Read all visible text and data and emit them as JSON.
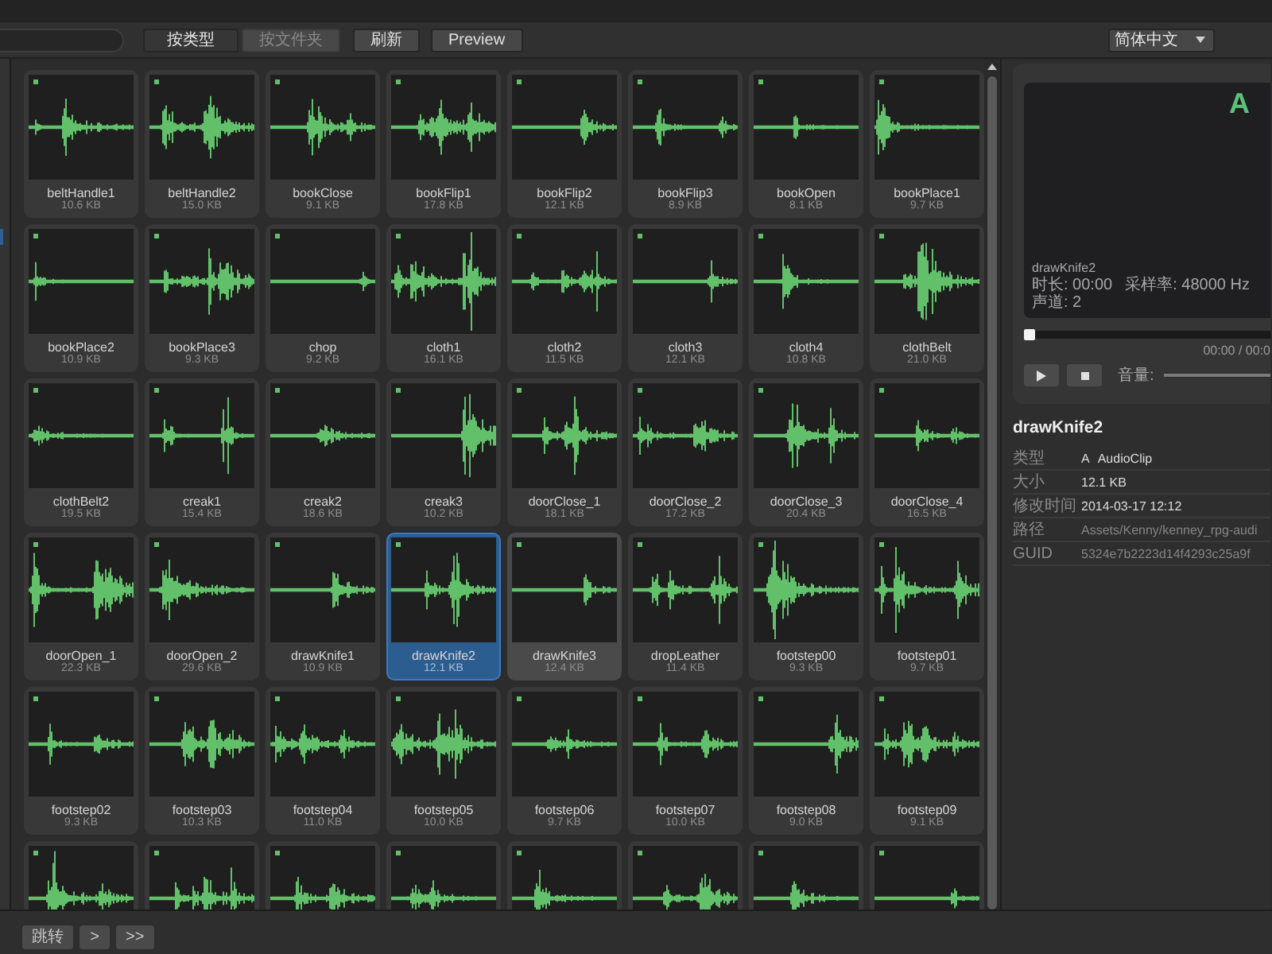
{
  "toolbar": {
    "view_toggle": [
      {
        "label": "按类型",
        "selected": true
      },
      {
        "label": "按文件夹",
        "selected": false
      }
    ],
    "buttons": [
      "刷新",
      "Preview"
    ],
    "language": "简体中文"
  },
  "clips": [
    {
      "kind": "clip",
      "name": "beltHandle1",
      "size": "10.6 KB",
      "selected": false,
      "hovered": false
    },
    {
      "kind": "clip",
      "name": "beltHandle2",
      "size": "15.0 KB",
      "selected": false,
      "hovered": false
    },
    {
      "kind": "clip",
      "name": "bookClose",
      "size": "9.1 KB",
      "selected": false,
      "hovered": false
    },
    {
      "kind": "clip",
      "name": "bookFlip1",
      "size": "17.8 KB",
      "selected": false,
      "hovered": false
    },
    {
      "kind": "clip",
      "name": "bookFlip2",
      "size": "12.1 KB",
      "selected": false,
      "hovered": false
    },
    {
      "kind": "clip",
      "name": "bookFlip3",
      "size": "8.9 KB",
      "selected": false,
      "hovered": false
    },
    {
      "kind": "clip",
      "name": "bookOpen",
      "size": "8.1 KB",
      "selected": false,
      "hovered": false
    },
    {
      "kind": "clip",
      "name": "bookPlace1",
      "size": "9.7 KB",
      "selected": false,
      "hovered": false
    },
    {
      "kind": "clip",
      "name": "bookPlace2",
      "size": "10.9 KB",
      "selected": false,
      "hovered": false
    },
    {
      "kind": "clip",
      "name": "bookPlace3",
      "size": "9.3 KB",
      "selected": false,
      "hovered": false
    },
    {
      "kind": "clip",
      "name": "chop",
      "size": "9.2 KB",
      "selected": false,
      "hovered": false
    },
    {
      "kind": "clip",
      "name": "cloth1",
      "size": "16.1 KB",
      "selected": false,
      "hovered": false
    },
    {
      "kind": "clip",
      "name": "cloth2",
      "size": "11.5 KB",
      "selected": false,
      "hovered": false
    },
    {
      "kind": "clip",
      "name": "cloth3",
      "size": "12.1 KB",
      "selected": false,
      "hovered": false
    },
    {
      "kind": "clip",
      "name": "cloth4",
      "size": "10.8 KB",
      "selected": false,
      "hovered": false
    },
    {
      "kind": "clip",
      "name": "clothBelt",
      "size": "21.0 KB",
      "selected": false,
      "hovered": false
    },
    {
      "kind": "clip",
      "name": "clothBelt2",
      "size": "19.5 KB",
      "selected": false,
      "hovered": false
    },
    {
      "kind": "clip",
      "name": "creak1",
      "size": "15.4 KB",
      "selected": false,
      "hovered": false
    },
    {
      "kind": "clip",
      "name": "creak2",
      "size": "18.6 KB",
      "selected": false,
      "hovered": false
    },
    {
      "kind": "clip",
      "name": "creak3",
      "size": "10.2 KB",
      "selected": false,
      "hovered": false
    },
    {
      "kind": "clip",
      "name": "doorClose_1",
      "size": "18.1 KB",
      "selected": false,
      "hovered": false
    },
    {
      "kind": "clip",
      "name": "doorClose_2",
      "size": "17.2 KB",
      "selected": false,
      "hovered": false
    },
    {
      "kind": "clip",
      "name": "doorClose_3",
      "size": "20.4 KB",
      "selected": false,
      "hovered": false
    },
    {
      "kind": "clip",
      "name": "doorClose_4",
      "size": "16.5 KB",
      "selected": false,
      "hovered": false
    },
    {
      "kind": "clip",
      "name": "doorOpen_1",
      "size": "22.3 KB",
      "selected": false,
      "hovered": false
    },
    {
      "kind": "clip",
      "name": "doorOpen_2",
      "size": "29.6 KB",
      "selected": false,
      "hovered": false
    },
    {
      "kind": "clip",
      "name": "drawKnife1",
      "size": "10.9 KB",
      "selected": false,
      "hovered": false
    },
    {
      "kind": "clip",
      "name": "drawKnife2",
      "size": "12.1 KB",
      "selected": true,
      "hovered": false
    },
    {
      "kind": "clip",
      "name": "drawKnife3",
      "size": "12.4 KB",
      "selected": false,
      "hovered": true
    },
    {
      "kind": "clip",
      "name": "dropLeather",
      "size": "11.4 KB",
      "selected": false,
      "hovered": false
    },
    {
      "kind": "clip",
      "name": "footstep00",
      "size": "9.3 KB",
      "selected": false,
      "hovered": false
    },
    {
      "kind": "clip",
      "name": "footstep01",
      "size": "9.7 KB",
      "selected": false,
      "hovered": false
    },
    {
      "kind": "clip",
      "name": "footstep02",
      "size": "9.3 KB",
      "selected": false,
      "hovered": false
    },
    {
      "kind": "clip",
      "name": "footstep03",
      "size": "10.3 KB",
      "selected": false,
      "hovered": false
    },
    {
      "kind": "clip",
      "name": "footstep04",
      "size": "11.0 KB",
      "selected": false,
      "hovered": false
    },
    {
      "kind": "clip",
      "name": "footstep05",
      "size": "10.0 KB",
      "selected": false,
      "hovered": false
    },
    {
      "kind": "clip",
      "name": "footstep06",
      "size": "9.7 KB",
      "selected": false,
      "hovered": false
    },
    {
      "kind": "clip",
      "name": "footstep07",
      "size": "10.0 KB",
      "selected": false,
      "hovered": false
    },
    {
      "kind": "clip",
      "name": "footstep08",
      "size": "9.0 KB",
      "selected": false,
      "hovered": false
    },
    {
      "kind": "clip",
      "name": "footstep09",
      "size": "9.1 KB",
      "selected": false,
      "hovered": false
    },
    {
      "kind": "clip_cut",
      "selected": false,
      "hovered": false
    },
    {
      "kind": "clip_cut",
      "selected": false,
      "hovered": false
    },
    {
      "kind": "clip_cut",
      "selected": false,
      "hovered": false
    },
    {
      "kind": "clip_cut",
      "selected": false,
      "hovered": false
    },
    {
      "kind": "clip_cut",
      "selected": false,
      "hovered": false
    },
    {
      "kind": "clip_cut",
      "selected": false,
      "hovered": false
    },
    {
      "kind": "clip_cut",
      "selected": false,
      "hovered": false
    },
    {
      "kind": "clip_cut",
      "selected": false,
      "hovered": false
    }
  ],
  "preview": {
    "type_letter": "A",
    "name": "drawKnife2",
    "info": [
      "时长: 00:00",
      "采样率: 48000 Hz",
      "声道: 2"
    ],
    "playback": {
      "level": 0,
      "time": "00:00 / 00:0"
    },
    "volume_label": "音量:",
    "volume": {
      "level": 1
    }
  },
  "details": {
    "title": "drawKnife2",
    "rows": [
      {
        "label": "类型",
        "icon": "A",
        "value": "AudioClip",
        "dimmed": false
      },
      {
        "label": "大小",
        "value": "12.1 KB",
        "dimmed": false
      },
      {
        "label": "修改时间",
        "value": "2014-03-17 12:12",
        "dimmed": false
      },
      {
        "label": "路径",
        "value": "Assets/Kenny/kenney_rpg-audi",
        "dimmed": true
      },
      {
        "label": "GUID",
        "value": "5324e7b2223d14f4293c25a9f",
        "dimmed": true
      }
    ]
  },
  "pager": [
    "跳转",
    ">",
    ">>"
  ]
}
